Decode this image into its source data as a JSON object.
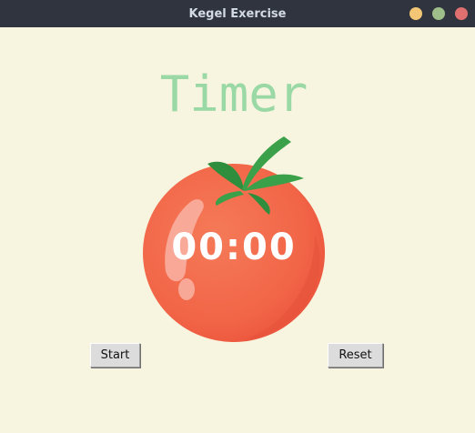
{
  "window": {
    "title": "Kegel Exercise",
    "controls": {
      "minimize_color": "#f2c675",
      "maximize_color": "#9fbf8a",
      "close_color": "#e07070"
    }
  },
  "main": {
    "heading": "Timer",
    "time": "00:00",
    "start_label": "Start",
    "reset_label": "Reset"
  },
  "colors": {
    "background": "#f7f5df",
    "heading": "#9ad8a6",
    "tomato": "#f26448",
    "leaf": "#3aa04a"
  }
}
